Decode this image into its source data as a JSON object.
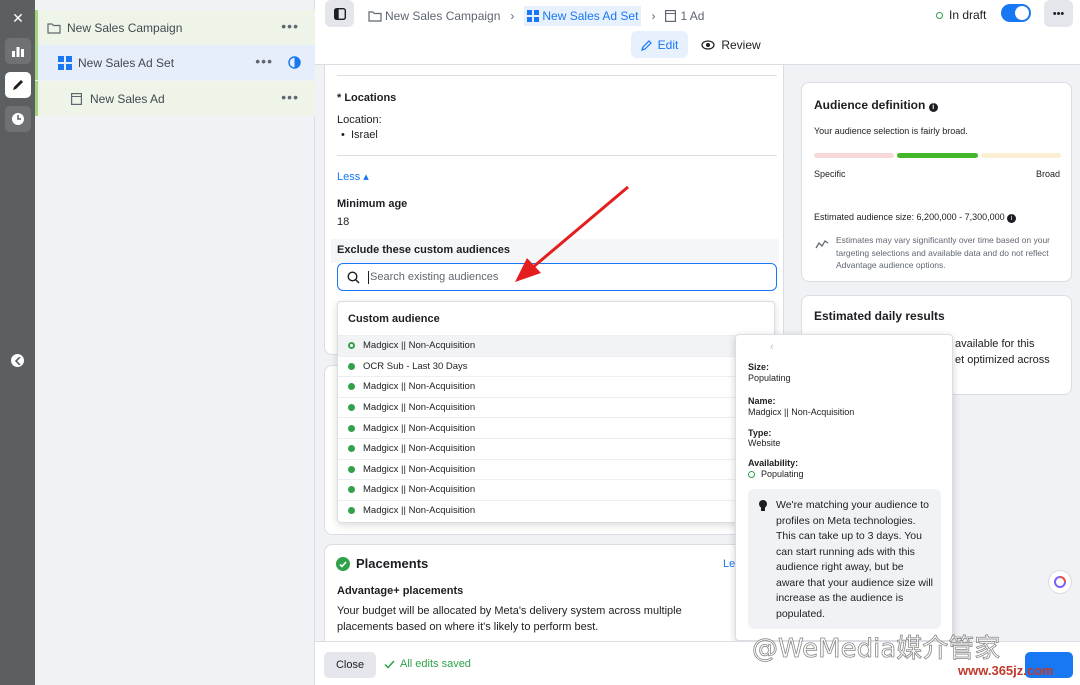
{
  "rail": {
    "close": "✕"
  },
  "tree": {
    "campaign": "New Sales Campaign",
    "adset": "New Sales Ad Set",
    "ad": "New Sales Ad",
    "dots": "•••"
  },
  "topbar": {
    "crumb_campaign": "New Sales Campaign",
    "crumb_adset": "New Sales Ad Set",
    "crumb_ad": "1 Ad",
    "status": "In draft",
    "edit": "Edit",
    "review": "Review",
    "more": "•••"
  },
  "locations": {
    "heading": "* Locations",
    "label": "Location:",
    "value": "Israel",
    "less": "Less ▴",
    "min_age_label": "Minimum age",
    "min_age_value": "18",
    "exclude_label": "Exclude these custom audiences",
    "search_placeholder": "Search existing audiences"
  },
  "dropdown": {
    "header": "Custom audience",
    "items": [
      {
        "name": "Madgicx || Non-Acquisition",
        "status": "populating"
      },
      {
        "name": "OCR Sub - Last 30 Days",
        "status": "ready"
      },
      {
        "name": "Madgicx || Non-Acquisition",
        "status": "ready"
      },
      {
        "name": "Madgicx || Non-Acquisition",
        "status": "ready"
      },
      {
        "name": "Madgicx || Non-Acquisition",
        "status": "ready"
      },
      {
        "name": "Madgicx || Non-Acquisition",
        "status": "ready"
      },
      {
        "name": "Madgicx || Non-Acquisition",
        "status": "ready"
      },
      {
        "name": "Madgicx || Non-Acquisition",
        "status": "ready"
      },
      {
        "name": "Madgicx || Non-Acquisition",
        "status": "ready"
      }
    ]
  },
  "tooltip": {
    "size_label": "Size:",
    "size_value": "Populating",
    "name_label": "Name:",
    "name_value": "Madgicx || Non-Acquisition",
    "type_label": "Type:",
    "type_value": "Website",
    "avail_label": "Availability:",
    "avail_value": "Populating",
    "note": "We're matching your audience to profiles on Meta technologies. This can take up to 3 days. You can start running ads with this audience right away, but be aware that your audience size will increase as the audience is populated."
  },
  "placements": {
    "title": "Placements",
    "learn": "Le",
    "adv_title": "Advantage+ placements",
    "adv_text": "Your budget will be allocated by Meta's delivery system across multiple placements based on where it's likely to perform best."
  },
  "audience_def": {
    "title": "Audience definition",
    "broad_text": "Your audience selection is fairly broad.",
    "specific": "Specific",
    "broad": "Broad",
    "estimated": "Estimated audience size: 6,200,000 - 7,300,000",
    "note": "Estimates may vary significantly over time based on your targeting selections and available data and do not reflect Advantage audience options."
  },
  "daily": {
    "title": "Estimated daily results",
    "line1": "available for this",
    "line2": "et optimized across"
  },
  "footer": {
    "close": "Close",
    "saved": "All edits saved"
  },
  "watermark": {
    "text": "@WeMedia媒介管家",
    "url": "www.365jz.com"
  },
  "colors": {
    "accent": "#1877f2",
    "green": "#31a24c",
    "arrow": "#e41e1e"
  }
}
